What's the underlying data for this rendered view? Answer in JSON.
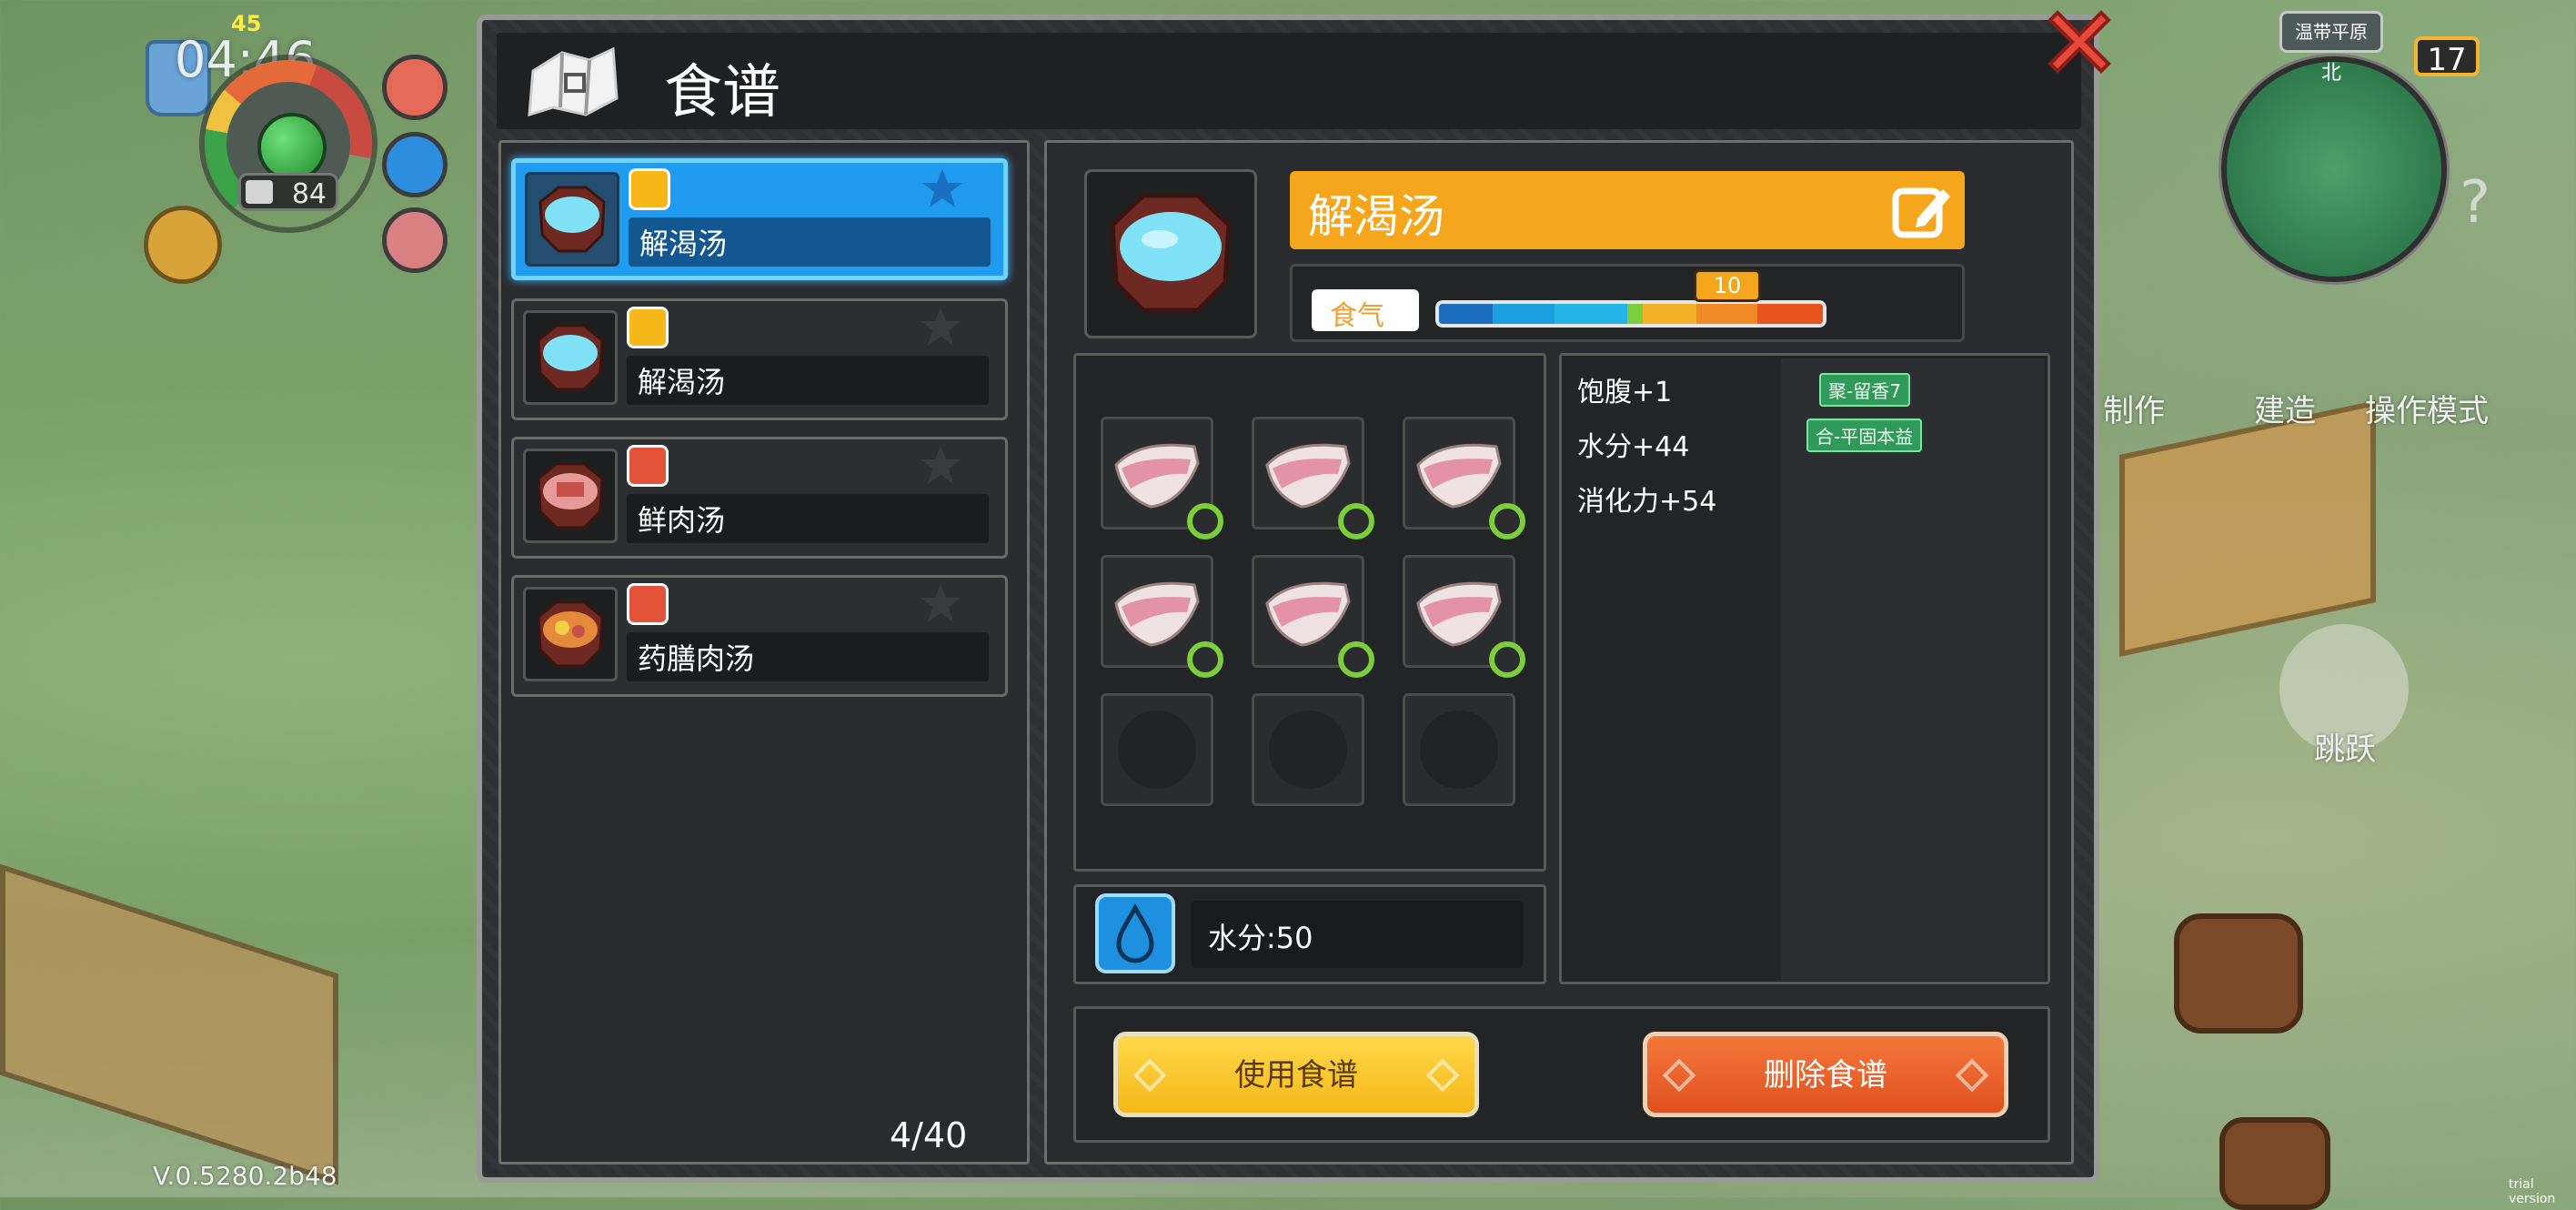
{
  "hud": {
    "time": "04:46",
    "time_badge": "45",
    "hp": "84",
    "version": "V.0.5280.2b48",
    "trial": "trial version"
  },
  "minimap": {
    "region": "温带平原",
    "north": "北"
  },
  "battery": "17",
  "side_buttons": {
    "make": "制作",
    "build": "建造",
    "mode": "操作模式",
    "jump": "跳跃"
  },
  "dialog": {
    "title": "食谱",
    "page_count": "4/40"
  },
  "recipes": [
    {
      "name": "解渴汤",
      "badge": "yellow",
      "selected": true
    },
    {
      "name": "解渴汤",
      "badge": "yellow",
      "selected": false
    },
    {
      "name": "鲜肉汤",
      "badge": "red",
      "selected": false
    },
    {
      "name": "药膳肉汤",
      "badge": "red",
      "selected": false
    }
  ],
  "detail": {
    "name": "解渴汤",
    "qi_label": "食气",
    "qi_value": "10",
    "effects": [
      "饱腹+1",
      "水分+44",
      "消化力+54"
    ],
    "tags": [
      "聚-留香7",
      "合-平固本益"
    ],
    "water": "水分:50",
    "ingredient_slots": [
      {
        "filled": true
      },
      {
        "filled": true
      },
      {
        "filled": true
      },
      {
        "filled": true
      },
      {
        "filled": true
      },
      {
        "filled": true
      },
      {
        "filled": false
      },
      {
        "filled": false
      },
      {
        "filled": false
      }
    ]
  },
  "buttons": {
    "use": "使用食谱",
    "delete": "删除食谱"
  },
  "colors": {
    "accent_orange": "#f5a61c",
    "selected_blue": "#1f9cf0",
    "delete_red": "#e0501e",
    "use_yellow": "#f5b818"
  }
}
